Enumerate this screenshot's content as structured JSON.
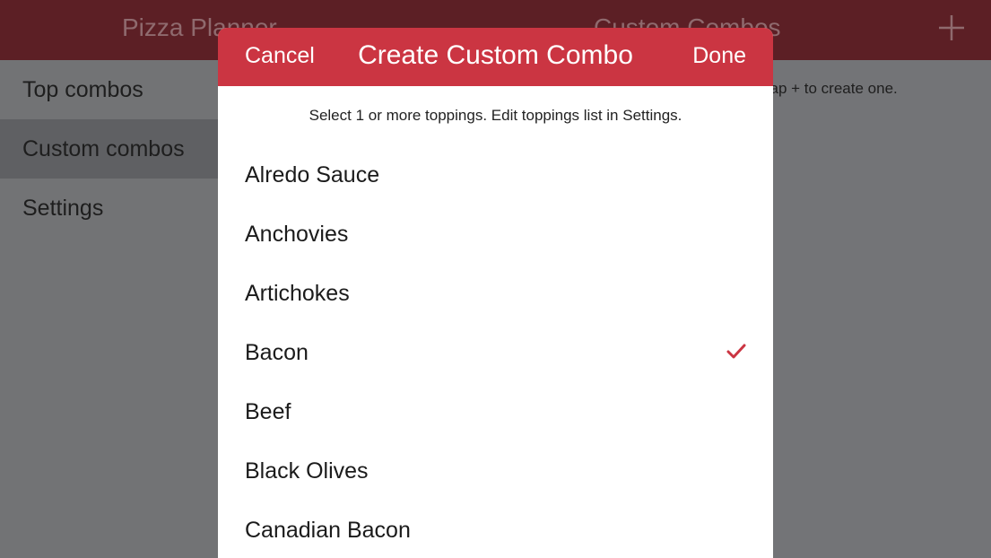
{
  "colors": {
    "accent": "#cb3542",
    "topbar_dimmed": "#5c1f25",
    "overlay": "#737477"
  },
  "topbar": {
    "app_title": "Pizza Planner",
    "section_title": "Custom Combos",
    "add_icon": "plus-icon"
  },
  "sidebar": {
    "items": [
      {
        "label": "Top combos",
        "active": false
      },
      {
        "label": "Custom combos",
        "active": true
      },
      {
        "label": "Settings",
        "active": false
      }
    ]
  },
  "main": {
    "empty_hint": "Tap + to create one."
  },
  "modal": {
    "cancel_label": "Cancel",
    "title": "Create Custom Combo",
    "done_label": "Done",
    "instruction": "Select 1 or more toppings. Edit toppings list in Settings.",
    "toppings": [
      {
        "label": "Alredo Sauce",
        "selected": false
      },
      {
        "label": "Anchovies",
        "selected": false
      },
      {
        "label": "Artichokes",
        "selected": false
      },
      {
        "label": "Bacon",
        "selected": true
      },
      {
        "label": "Beef",
        "selected": false
      },
      {
        "label": "Black Olives",
        "selected": false
      },
      {
        "label": "Canadian Bacon",
        "selected": false
      }
    ],
    "check_icon": "checkmark-icon"
  }
}
